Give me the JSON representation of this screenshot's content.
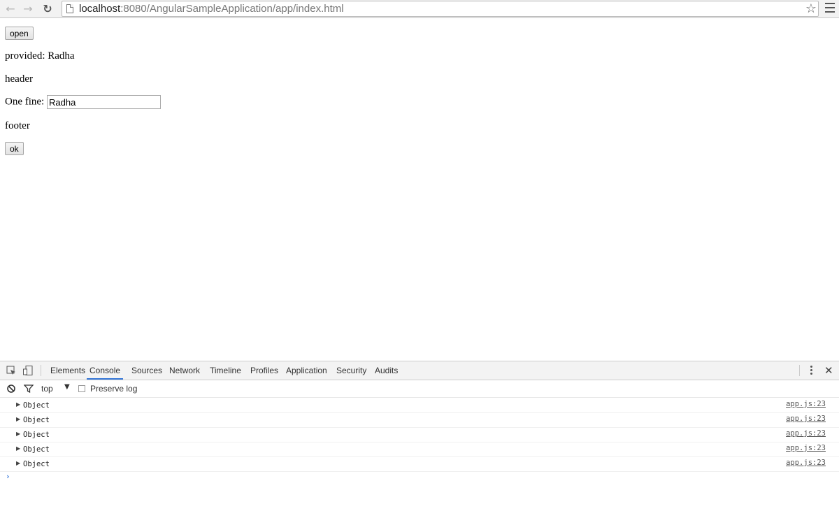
{
  "browser": {
    "url_host": "localhost",
    "url_path": ":8080/AngularSampleApplication/app/index.html",
    "icons": [
      "back-icon",
      "forward-icon",
      "reload-icon",
      "page-icon",
      "star-icon",
      "menu-icon"
    ]
  },
  "page": {
    "open_button": "open",
    "provided_text": "provided: Radha",
    "header_text": "header",
    "one_fine_label": "One fine:",
    "name_input_value": "Radha",
    "footer_text": "footer",
    "ok_button": "ok"
  },
  "devtools": {
    "tabs": [
      {
        "label": "Elements",
        "active": false
      },
      {
        "label": "Console",
        "active": true
      },
      {
        "label": "Sources",
        "active": false
      },
      {
        "label": "Network",
        "active": false
      },
      {
        "label": "Timeline",
        "active": false
      },
      {
        "label": "Profiles",
        "active": false
      },
      {
        "label": "Application",
        "active": false
      },
      {
        "label": "Security",
        "active": false
      },
      {
        "label": "Audits",
        "active": false
      }
    ],
    "toolbar": {
      "context": "top",
      "preserve_log": "Preserve log"
    },
    "messages": [
      {
        "text": "Object",
        "source": "app.js:23"
      },
      {
        "text": "Object",
        "source": "app.js:23"
      },
      {
        "text": "Object",
        "source": "app.js:23"
      },
      {
        "text": "Object",
        "source": "app.js:23"
      },
      {
        "text": "Object",
        "source": "app.js:23"
      }
    ],
    "accent_color": "#3879d9"
  }
}
